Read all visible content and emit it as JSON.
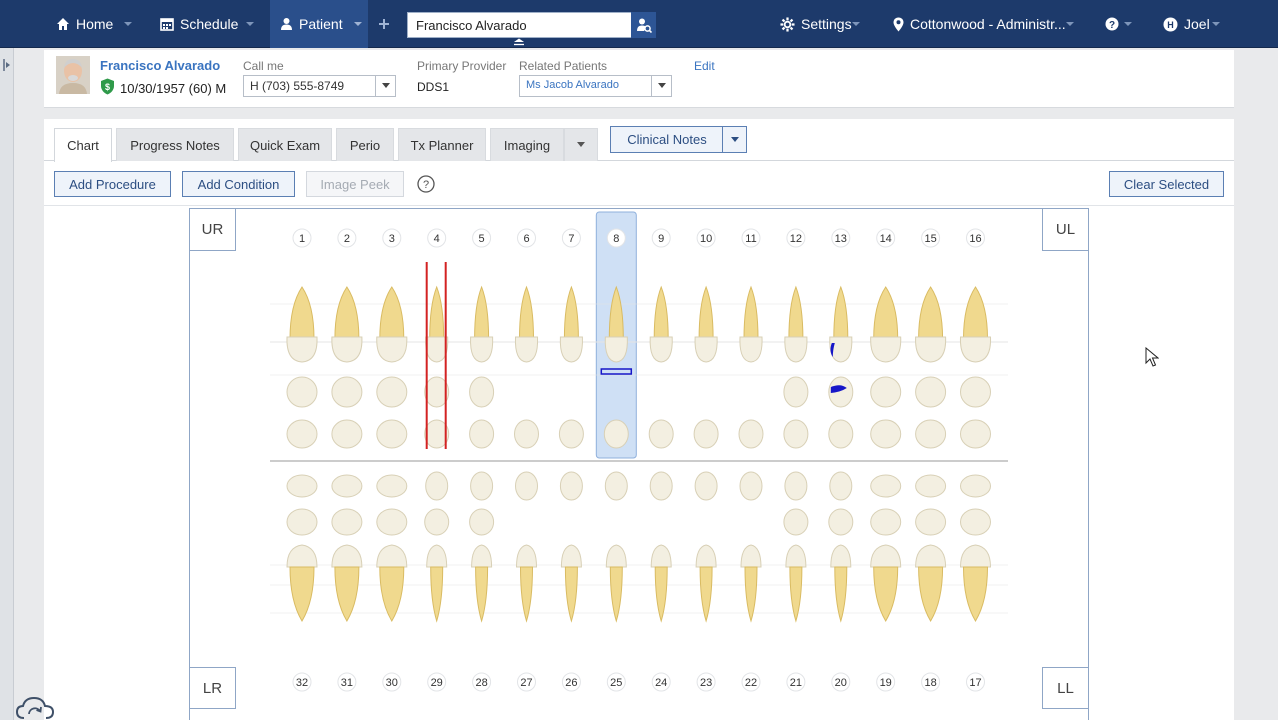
{
  "nav": {
    "home": "Home",
    "schedule": "Schedule",
    "patient": "Patient",
    "search_value": "Francisco Alvarado",
    "settings": "Settings",
    "location": "Cottonwood - Administr...",
    "user": "Joel"
  },
  "patient": {
    "name": "Francisco Alvarado",
    "dob": "10/30/1957 (60) M",
    "call_me_label": "Call me",
    "call_me_value": "H (703) 555-8749",
    "provider_label": "Primary Provider",
    "provider_value": "DDS1",
    "related_label": "Related Patients",
    "related_value": "Ms Jacob Alvarado",
    "edit": "Edit"
  },
  "tabs": [
    "Chart",
    "Progress Notes",
    "Quick Exam",
    "Perio",
    "Tx Planner",
    "Imaging"
  ],
  "clinical_notes": "Clinical Notes",
  "toolbar": {
    "add_procedure": "Add Procedure",
    "add_condition": "Add Condition",
    "image_peek": "Image Peek",
    "clear_selected": "Clear Selected"
  },
  "chart": {
    "quadrants": {
      "ur": "UR",
      "ul": "UL",
      "lr": "LR",
      "ll": "LL"
    },
    "upper_numbers": [
      "1",
      "2",
      "3",
      "4",
      "5",
      "6",
      "7",
      "8",
      "9",
      "10",
      "11",
      "12",
      "13",
      "14",
      "15",
      "16"
    ],
    "lower_numbers": [
      "32",
      "31",
      "30",
      "29",
      "28",
      "27",
      "26",
      "25",
      "24",
      "23",
      "22",
      "21",
      "20",
      "19",
      "18",
      "17"
    ],
    "selected_tooth": "8",
    "marked_tooth": "4",
    "filled_tooth": "13"
  },
  "colors": {
    "nav_bg": "#1d3a6b",
    "accent": "#3a74c0",
    "selection": "#cfe0f5",
    "red_mark": "#d32222",
    "filling": "#1616c8"
  }
}
